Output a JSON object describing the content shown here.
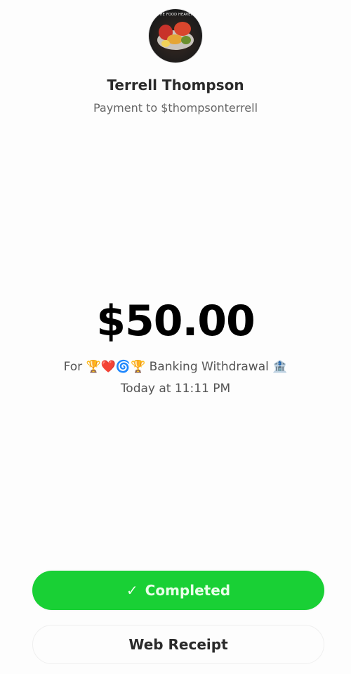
{
  "recipient": {
    "name": "Terrell Thompson",
    "subtitle": "Payment to $thompsonterrell",
    "avatar_lettering": "THE FOOD HEAVEN"
  },
  "payment": {
    "amount": "$50.00",
    "memo": "For 🏆❤️🌀🏆 Banking Withdrawal 🏦",
    "timestamp": "Today at 11:11 PM"
  },
  "actions": {
    "completed_label": "Completed",
    "completed_icon": "check-icon",
    "web_receipt_label": "Web Receipt"
  },
  "colors": {
    "accent_green": "#19d035",
    "background": "#fdfdfd"
  }
}
